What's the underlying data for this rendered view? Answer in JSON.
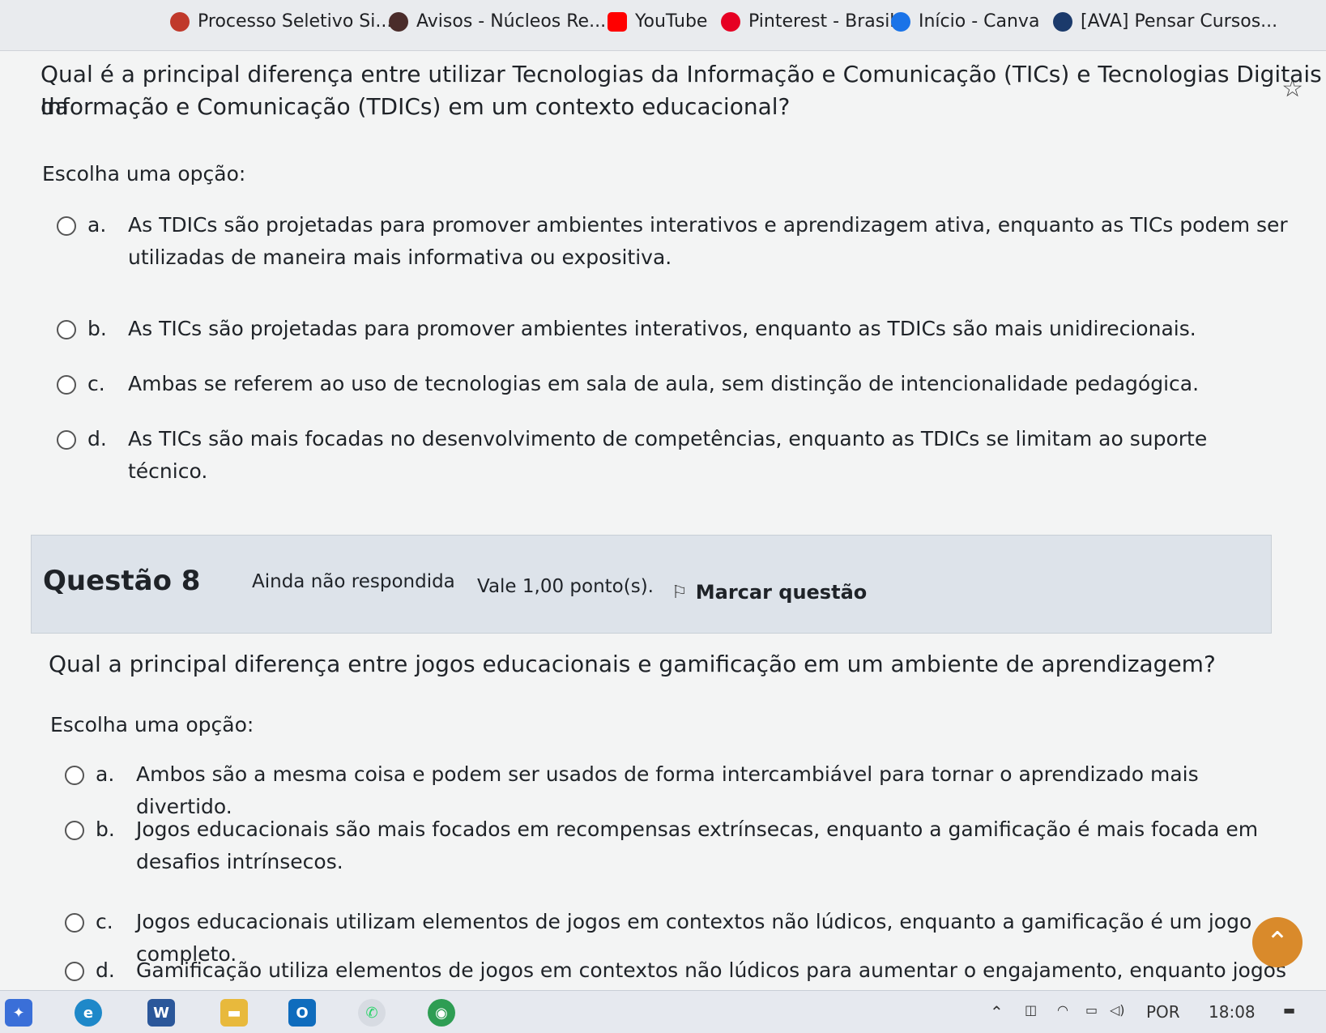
{
  "bookmarks": [
    {
      "label": "Processo Seletivo Si...",
      "icon": "feather-icon",
      "color": "#c0392b"
    },
    {
      "label": "Avisos - Núcleos Re...",
      "icon": "flower-icon",
      "color": "#4a2c2a"
    },
    {
      "label": "YouTube",
      "icon": "youtube-icon",
      "color": "#ff0000"
    },
    {
      "label": "Pinterest - Brasil",
      "icon": "pinterest-icon",
      "color": "#e60023"
    },
    {
      "label": "Início - Canva",
      "icon": "canva-icon",
      "color": "#1a73e8"
    },
    {
      "label": "[AVA] Pensar Cursos...",
      "icon": "ava-icon",
      "color": "#1b3a6b"
    }
  ],
  "question7": {
    "text_line1": "Qual é a principal diferença entre utilizar Tecnologias da Informação e Comunicação (TICs) e Tecnologias Digitais da",
    "text_line2": "Informação e Comunicação (TDICs) em um contexto educacional?",
    "choose_label": "Escolha uma opção:",
    "options": [
      {
        "letter": "a.",
        "text": "As TDICs são projetadas para promover ambientes interativos e aprendizagem ativa, enquanto as TICs podem ser utilizadas de maneira mais informativa ou expositiva."
      },
      {
        "letter": "b.",
        "text": "As TICs são projetadas para promover ambientes interativos, enquanto as TDICs são mais unidirecionais."
      },
      {
        "letter": "c.",
        "text": "Ambas se referem ao uso de tecnologias em sala de aula, sem distinção de intencionalidade pedagógica."
      },
      {
        "letter": "d.",
        "text": "As TICs são mais focadas no desenvolvimento de competências, enquanto as TDICs se limitam ao suporte técnico."
      }
    ]
  },
  "question8": {
    "number_label": "Questão 8",
    "state": "Ainda não respondida",
    "value": "Vale 1,00 ponto(s).",
    "flag_label": "Marcar questão",
    "text": "Qual a principal diferença entre jogos educacionais e gamificação em um ambiente de aprendizagem?",
    "choose_label": "Escolha uma opção:",
    "options": [
      {
        "letter": "a.",
        "text": "Ambos são a mesma coisa e podem ser usados de forma intercambiável para tornar o aprendizado mais divertido."
      },
      {
        "letter": "b.",
        "text": "Jogos educacionais são mais focados em recompensas extrínsecas, enquanto a gamificação é mais focada em desafios intrínsecos."
      },
      {
        "letter": "c.",
        "text": "Jogos educacionais utilizam elementos de jogos em contextos não lúdicos, enquanto a gamificação é um jogo completo."
      },
      {
        "letter": "d.",
        "text": "Gamificação utiliza elementos de jogos em contextos não lúdicos para aumentar o engajamento, enquanto jogos educacionais"
      }
    ]
  },
  "taskbar": {
    "language": "POR",
    "time": "18:08",
    "apps": [
      "start",
      "edge",
      "word",
      "files",
      "outlook",
      "whatsapp",
      "chrome"
    ]
  },
  "colors": {
    "accent": "#d98a2b",
    "question_box": "#dde3ea"
  }
}
